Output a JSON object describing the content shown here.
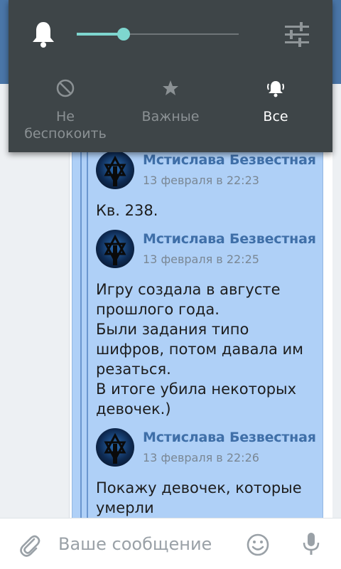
{
  "notification_panel": {
    "bell_icon": "bell-icon",
    "volume_level_percent": 29,
    "settings_icon": "sliders-icon",
    "modes": [
      {
        "icon": "do-not-disturb-icon",
        "label": "Не\nбеспокоить",
        "active": false
      },
      {
        "icon": "star-icon",
        "label": "Важные",
        "active": false
      },
      {
        "icon": "ringing-bell-icon",
        "label": "Все",
        "active": true
      }
    ],
    "accent_color": "#7ed6cf"
  },
  "chat": {
    "messages": [
      {
        "author": "Мстислава Безвестная",
        "date": "13 февраля в 22:23",
        "text": "Кв. 238."
      },
      {
        "author": "Мстислава Безвестная",
        "date": "13 февраля в 22:25",
        "text": "Игру создала в августе\nпрошлого года.\nБыли задания типо\nшифров, потом давала им\nрезаться.\nВ итоге убила некоторых\nдевочек.)"
      },
      {
        "author": "Мстислава Безвестная",
        "date": "13 февраля в 22:26",
        "text": "Покажу девочек, которые\nумерли"
      }
    ],
    "bubble_color": "#afd0f7",
    "author_color": "#3f6fa8"
  },
  "input_bar": {
    "placeholder": "Ваше сообщение",
    "attach_icon": "paperclip-icon",
    "emoji_icon": "smile-icon",
    "mic_icon": "microphone-icon"
  }
}
